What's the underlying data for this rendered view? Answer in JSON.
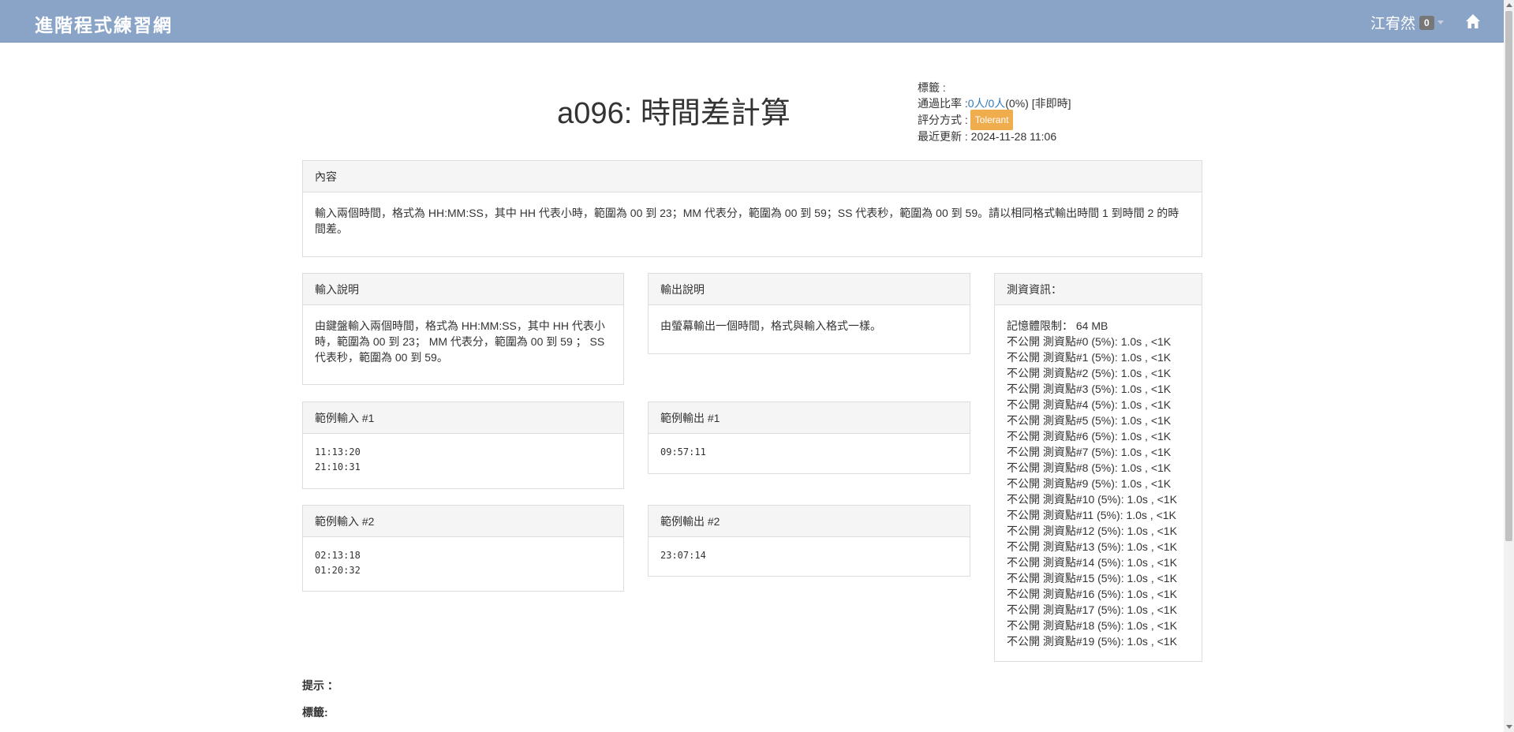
{
  "nav": {
    "brand": "進階程式練習網",
    "user_name": "江宥然",
    "badge_count": "0",
    "home_icon": "home-icon"
  },
  "problem": {
    "title": "a096: 時間差計算",
    "tags_label": "標籤 :",
    "pass_label": "通過比率 : ",
    "pass_link": "0人/0人",
    "pass_suffix": " (0%) [非即時]",
    "grading_label": "評分方式 : ",
    "grading_badge": "Tolerant",
    "updated": "最近更新 : 2024-11-28 11:06"
  },
  "content": {
    "heading": "內容",
    "text": "輸入兩個時間，格式為 HH:MM:SS，其中 HH 代表小時，範圍為 00 到 23；MM 代表分，範圍為 00 到 59；SS 代表秒，範圍為 00 到 59。請以相同格式輸出時間 1 到時間 2 的時間差。"
  },
  "input_desc": {
    "heading": "輸入說明",
    "text": "由鍵盤輸入兩個時間，格式為 HH:MM:SS，其中 HH 代表小時，範圍為 00 到 23； MM 代表分，範圍為 00 到 59 ； SS 代表秒，範圍為 00 到 59。"
  },
  "output_desc": {
    "heading": "輸出說明",
    "text": "由螢幕輸出一個時間，格式與輸入格式一樣。"
  },
  "sample_input_1": {
    "heading": "範例輸入 #1",
    "text": "11:13:20\n21:10:31"
  },
  "sample_output_1": {
    "heading": "範例輸出 #1",
    "text": "09:57:11"
  },
  "sample_input_2": {
    "heading": "範例輸入 #2",
    "text": "02:13:18\n01:20:32"
  },
  "sample_output_2": {
    "heading": "範例輸出 #2",
    "text": "23:07:14"
  },
  "testdata": {
    "heading": "測資資訊：",
    "memory": "記憶體限制： 64 MB",
    "items": [
      "不公開 測資點#0 (5%): 1.0s , <1K",
      "不公開 測資點#1 (5%): 1.0s , <1K",
      "不公開 測資點#2 (5%): 1.0s , <1K",
      "不公開 測資點#3 (5%): 1.0s , <1K",
      "不公開 測資點#4 (5%): 1.0s , <1K",
      "不公開 測資點#5 (5%): 1.0s , <1K",
      "不公開 測資點#6 (5%): 1.0s , <1K",
      "不公開 測資點#7 (5%): 1.0s , <1K",
      "不公開 測資點#8 (5%): 1.0s , <1K",
      "不公開 測資點#9 (5%): 1.0s , <1K",
      "不公開 測資點#10 (5%): 1.0s , <1K",
      "不公開 測資點#11 (5%): 1.0s , <1K",
      "不公開 測資點#12 (5%): 1.0s , <1K",
      "不公開 測資點#13 (5%): 1.0s , <1K",
      "不公開 測資點#14 (5%): 1.0s , <1K",
      "不公開 測資點#15 (5%): 1.0s , <1K",
      "不公開 測資點#16 (5%): 1.0s , <1K",
      "不公開 測資點#17 (5%): 1.0s , <1K",
      "不公開 測資點#18 (5%): 1.0s , <1K",
      "不公開 測資點#19 (5%): 1.0s , <1K"
    ]
  },
  "footer": {
    "hint_label": "提示 ：",
    "tags_label": "標籤:"
  },
  "colors": {
    "navbar": "#8aa4c8",
    "link": "#337ab7",
    "badge_tolerant": "#f0ad4e"
  }
}
